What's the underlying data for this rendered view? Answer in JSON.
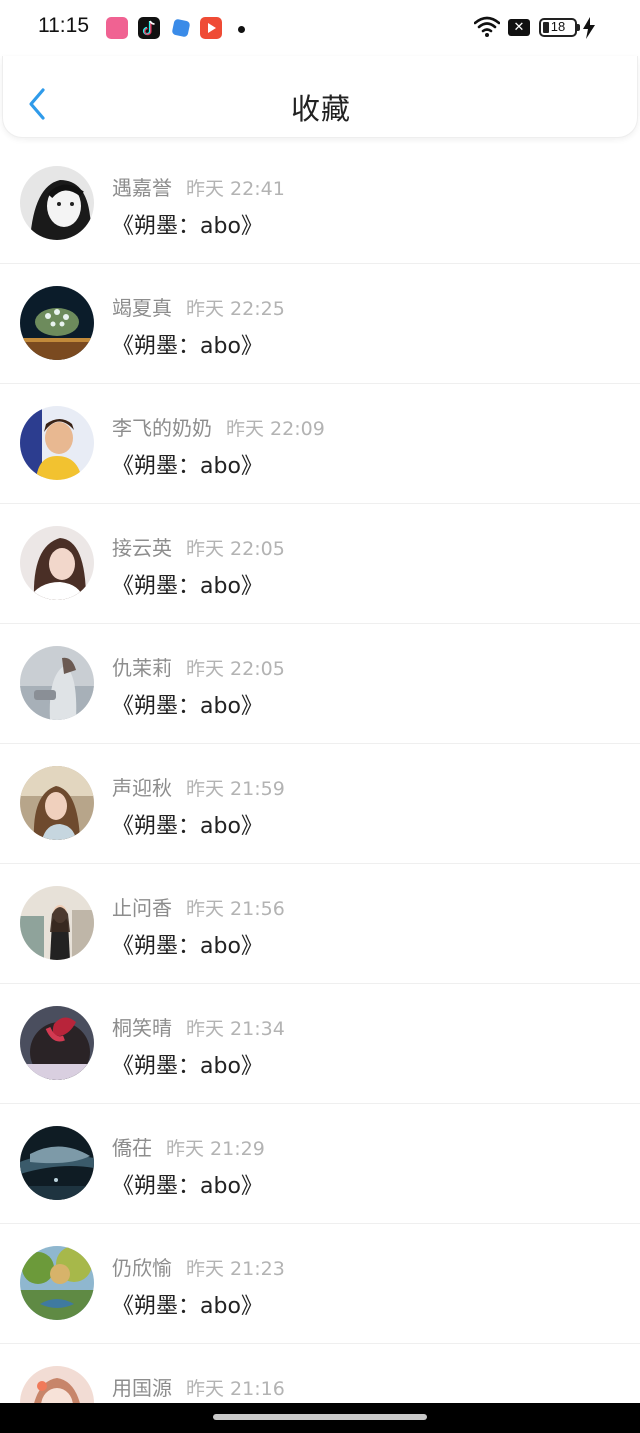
{
  "status_bar": {
    "time": "11:15",
    "battery": "18",
    "icons": [
      "lofter-app-icon",
      "tiktok-icon",
      "blue-app-icon",
      "video-app-icon",
      "notification-dot",
      "wifi-icon",
      "no-sim-icon",
      "battery-icon",
      "charging-icon"
    ]
  },
  "header": {
    "title": "收藏",
    "back_icon": "chevron-left-icon",
    "accent_color": "#2f9bea"
  },
  "list": {
    "items": [
      {
        "name": "遇嘉誉",
        "time": "昨天 22:41",
        "message": "《朔墨：abo》"
      },
      {
        "name": "竭夏真",
        "time": "昨天 22:25",
        "message": "《朔墨：abo》"
      },
      {
        "name": "李飞的奶奶",
        "time": "昨天 22:09",
        "message": "《朔墨：abo》"
      },
      {
        "name": "接云英",
        "time": "昨天 22:05",
        "message": "《朔墨：abo》"
      },
      {
        "name": "仇茉莉",
        "time": "昨天 22:05",
        "message": "《朔墨：abo》"
      },
      {
        "name": "声迎秋",
        "time": "昨天 21:59",
        "message": "《朔墨：abo》"
      },
      {
        "name": "止问香",
        "time": "昨天 21:56",
        "message": "《朔墨：abo》"
      },
      {
        "name": "桐笑晴",
        "time": "昨天 21:34",
        "message": "《朔墨：abo》"
      },
      {
        "name": "僑茌",
        "time": "昨天 21:29",
        "message": "《朔墨：abo》"
      },
      {
        "name": "仍欣愉",
        "time": "昨天 21:23",
        "message": "《朔墨：abo》"
      },
      {
        "name": "用国源",
        "time": "昨天 21:16",
        "message": ""
      }
    ]
  },
  "colors": {
    "name_text": "#8d8d8d",
    "time_text": "#b3b3b3",
    "message_text": "#222222"
  }
}
